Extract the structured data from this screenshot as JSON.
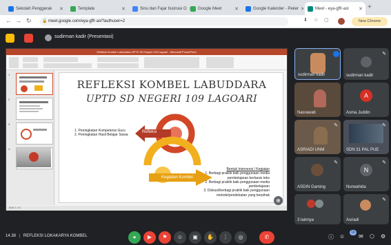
{
  "tabs": [
    {
      "title": "Sekolah Penggerak",
      "color": "#1a73e8",
      "active": false
    },
    {
      "title": "Template",
      "color": "#34a853",
      "active": false
    },
    {
      "title": "Sinu dan Fajar Ilustrasi O",
      "color": "#4285f4",
      "active": false
    },
    {
      "title": "Google Meet",
      "color": "#34a853",
      "active": false
    },
    {
      "title": "Google Kalender - Peker",
      "color": "#1a73e8",
      "active": false
    },
    {
      "title": "Meet - eya-gffr-asl",
      "color": "#00897b",
      "active": true
    }
  ],
  "address": {
    "url": "meet.google.com/eya-gffr-asl?authuser=2",
    "update_label": "New Chrome available"
  },
  "presenter": {
    "label": "sudirman kadir (Presentasi)"
  },
  "presentation": {
    "title_bar": "Refleksi Kombel Labuddara UPTD SD Negeri 109 Lagoari - Microsoft PowerPoint",
    "slide_title_line1": "REFLEKSI KOMBEL LABUDDARA",
    "slide_title_line2": "UPTD SD NEGERI 109 LAGOARI",
    "points": [
      "1. Peningkatan Kompetensi Guru",
      "2. Peningkatan Hasil Belajar Siswa"
    ],
    "arrow_label_1": "Refleksi",
    "arrow_label_2": "Kegiatan Kombel",
    "right_note": [
      "Bentuk Intervensi / Kegiatan",
      "1. Berbagi praktik baik penggunaan media pembelajaran berbasis teks",
      "2. Berbagi praktik baik penggunaan media pembelajaran",
      "3. Diskusi/berbagi praktik baik penggunaan metode/pendekatan yang berpihak"
    ],
    "status": "Slide 1 of 1"
  },
  "participants": [
    {
      "name": "sudirman kadir",
      "initial": "",
      "color": "#3c4043"
    },
    {
      "name": "sudirman kadir",
      "initial": "",
      "color": "#3c4043"
    },
    {
      "name": "Nasrawati",
      "initial": "",
      "color": "#5a4a3c"
    },
    {
      "name": "Asma Juddin",
      "initial": "A",
      "color": "#d93025"
    },
    {
      "name": "ASRIADI UNM",
      "initial": "",
      "color": "#6b5a4a"
    },
    {
      "name": "SDN 31 PAL PUE",
      "initial": "",
      "color": "#4a4f5a"
    },
    {
      "name": "ASDIN Gaming",
      "initial": "",
      "color": "#3c4043"
    },
    {
      "name": "Nurwahida",
      "initial": "N",
      "color": "#5f6368"
    },
    {
      "name": "3 lainnya",
      "initial": "",
      "color": "#3c4043"
    },
    {
      "name": "Asriadi",
      "initial": "",
      "color": "#3c4043"
    }
  ],
  "meeting": {
    "time": "14.38",
    "separator": "|",
    "title": "REFLEKSI LOKAKARYA KOMBEL",
    "badge": "10"
  },
  "controls": [
    "mic-icon",
    "camera-icon",
    "captions-icon",
    "emoji-icon",
    "present-icon",
    "raise-hand-icon",
    "more-icon",
    "hangup-icon"
  ]
}
